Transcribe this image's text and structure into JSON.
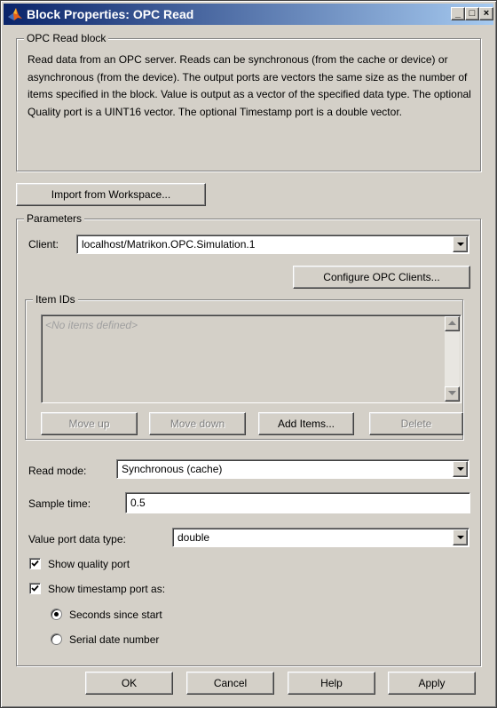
{
  "window": {
    "title": "Block Properties: OPC Read",
    "controls": {
      "minimize": "_",
      "maximize": "□",
      "close": "×"
    }
  },
  "block_group": {
    "label": "OPC Read block",
    "description": "Read data from an OPC server. Reads can be synchronous (from the cache or device) or asynchronous (from the device). The output ports are vectors the same size as the number of items specified in the block. Value is output as a vector of the specified data type. The optional Quality port is a UINT16 vector. The optional Timestamp port is a double vector."
  },
  "import_button": "Import from Workspace...",
  "parameters": {
    "label": "Parameters",
    "client_label": "Client:",
    "client_value": "localhost/Matrikon.OPC.Simulation.1",
    "configure_button": "Configure OPC Clients...",
    "item_ids": {
      "label": "Item IDs",
      "placeholder": "<No items defined>",
      "buttons": {
        "move_up": "Move up",
        "move_down": "Move down",
        "add_items": "Add Items...",
        "delete": "Delete"
      }
    },
    "read_mode_label": "Read mode:",
    "read_mode_value": "Synchronous (cache)",
    "sample_time_label": "Sample time:",
    "sample_time_value": "0.5",
    "value_port_label": "Value port data type:",
    "value_port_value": "double",
    "show_quality_label": "Show quality port",
    "show_quality_checked": true,
    "show_timestamp_label": "Show timestamp port as:",
    "show_timestamp_checked": true,
    "timestamp_options": [
      {
        "label": "Seconds since start",
        "selected": true
      },
      {
        "label": "Serial date number",
        "selected": false
      }
    ]
  },
  "footer": {
    "ok": "OK",
    "cancel": "Cancel",
    "help": "Help",
    "apply": "Apply"
  }
}
